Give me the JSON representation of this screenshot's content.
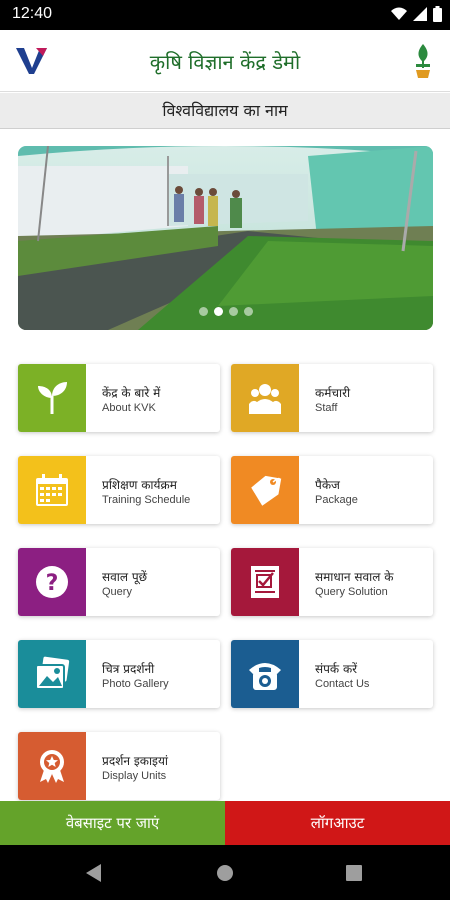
{
  "status": {
    "time": "12:40"
  },
  "header": {
    "title": "कृषि विज्ञान केंद्र डेमो",
    "subtitle": "विश्वविद्यालय का नाम"
  },
  "carousel": {
    "slide_count": 4,
    "active_index": 1
  },
  "menu": [
    {
      "hi": "केंद्र के बारे में",
      "en": "About KVK",
      "color": "#7cb126",
      "icon": "sprout-icon"
    },
    {
      "hi": "कर्मचारी",
      "en": "Staff",
      "color": "#e0a825",
      "icon": "people-icon"
    },
    {
      "hi": "प्रशिक्षण कार्यक्रम",
      "en": "Training Schedule",
      "color": "#f3c11b",
      "icon": "calendar-icon"
    },
    {
      "hi": "पैकेज",
      "en": "Package",
      "color": "#f08a23",
      "icon": "tag-icon"
    },
    {
      "hi": "सवाल पूछें",
      "en": "Query",
      "color": "#8c1f82",
      "icon": "question-icon"
    },
    {
      "hi": "समाधान सवाल के",
      "en": "Query Solution",
      "color": "#a5183b",
      "icon": "document-icon"
    },
    {
      "hi": "चित्र प्रदर्शनी",
      "en": "Photo Gallery",
      "color": "#1a8d9a",
      "icon": "photos-icon"
    },
    {
      "hi": "संपर्क करें",
      "en": "Contact Us",
      "color": "#1b5d91",
      "icon": "phone-icon"
    },
    {
      "hi": "प्रदर्शन इकाइयां",
      "en": "Display Units",
      "color": "#d65c31",
      "icon": "badge-icon"
    }
  ],
  "footer": {
    "website_label": "वेबसाइट पर जाएं",
    "website_color": "#64a32a",
    "logout_label": "लॉगआउट",
    "logout_color": "#d01717"
  }
}
